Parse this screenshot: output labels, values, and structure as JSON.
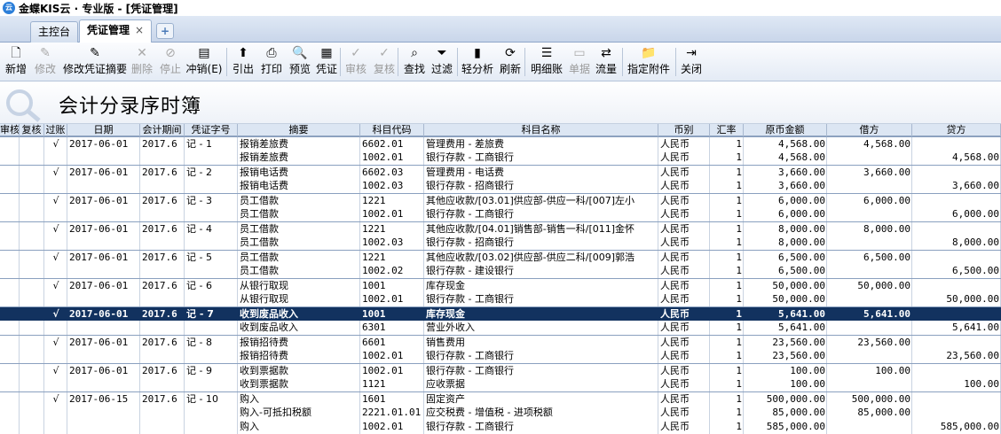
{
  "window": {
    "title": "金蝶KIS云 · 专业版 - [凭证管理]"
  },
  "tabs": [
    {
      "label": "主控台",
      "active": false
    },
    {
      "label": "凭证管理",
      "active": true,
      "close": "×"
    }
  ],
  "tab_add": "+",
  "toolbar": [
    {
      "label": "新增",
      "icon": "new-doc-icon",
      "glyph": "🗋",
      "enabled": true
    },
    {
      "label": "修改",
      "icon": "edit-icon",
      "glyph": "✎",
      "enabled": false
    },
    {
      "label": "修改凭证摘要",
      "icon": "edit-summary-icon",
      "glyph": "✎",
      "enabled": true
    },
    {
      "label": "删除",
      "icon": "delete-icon",
      "glyph": "✕",
      "enabled": false
    },
    {
      "label": "停止",
      "icon": "stop-icon",
      "glyph": "⊘",
      "enabled": false
    },
    {
      "label": "冲销(E)",
      "icon": "reverse-icon",
      "glyph": "▤",
      "enabled": true
    },
    {
      "label": "引出",
      "icon": "export-icon",
      "glyph": "⬆",
      "enabled": true
    },
    {
      "label": "打印",
      "icon": "print-icon",
      "glyph": "⎙",
      "enabled": true
    },
    {
      "label": "预览",
      "icon": "preview-icon",
      "glyph": "🔍",
      "enabled": true
    },
    {
      "label": "凭证",
      "icon": "voucher-icon",
      "glyph": "▦",
      "enabled": true
    },
    {
      "label": "审核",
      "icon": "audit-icon",
      "glyph": "✓",
      "enabled": false
    },
    {
      "label": "复核",
      "icon": "recheck-icon",
      "glyph": "✓",
      "enabled": false
    },
    {
      "label": "查找",
      "icon": "find-icon",
      "glyph": "⌕",
      "enabled": true
    },
    {
      "label": "过滤",
      "icon": "filter-icon",
      "glyph": "⏷",
      "enabled": true
    },
    {
      "label": "轻分析",
      "icon": "analysis-icon",
      "glyph": "▮",
      "enabled": true
    },
    {
      "label": "刷新",
      "icon": "refresh-icon",
      "glyph": "⟳",
      "enabled": true
    },
    {
      "label": "明细账",
      "icon": "ledger-icon",
      "glyph": "☰",
      "enabled": true
    },
    {
      "label": "单据",
      "icon": "document-icon",
      "glyph": "▭",
      "enabled": false
    },
    {
      "label": "流量",
      "icon": "flow-icon",
      "glyph": "⇄",
      "enabled": true
    },
    {
      "label": "指定附件",
      "icon": "attachment-icon",
      "glyph": "📁",
      "enabled": true
    },
    {
      "label": "关闭",
      "icon": "exit-icon",
      "glyph": "⇥",
      "enabled": true
    }
  ],
  "banner": {
    "title": "会计分录序时簿"
  },
  "columns": [
    "审核",
    "复核",
    "过账",
    "日期",
    "会计期间",
    "凭证字号",
    "摘要",
    "科目代码",
    "科目名称",
    "币别",
    "汇率",
    "原币金额",
    "借方",
    "贷方"
  ],
  "rows": [
    {
      "posted": "√",
      "date": "2017-06-01",
      "period": "2017.6",
      "voucher": "记 - 1",
      "summary": "报销差旅费",
      "code": "6602.01",
      "name": "管理费用 - 差旅费",
      "currency": "人民币",
      "rate": "1",
      "amount": "4,568.00",
      "debit": "4,568.00",
      "credit": ""
    },
    {
      "posted": "",
      "date": "",
      "period": "",
      "voucher": "",
      "summary": "报销差旅费",
      "code": "1002.01",
      "name": "银行存款 - 工商银行",
      "currency": "人民币",
      "rate": "1",
      "amount": "4,568.00",
      "debit": "",
      "credit": "4,568.00"
    },
    {
      "posted": "√",
      "date": "2017-06-01",
      "period": "2017.6",
      "voucher": "记 - 2",
      "summary": "报销电话费",
      "code": "6602.03",
      "name": "管理费用 - 电话费",
      "currency": "人民币",
      "rate": "1",
      "amount": "3,660.00",
      "debit": "3,660.00",
      "credit": ""
    },
    {
      "posted": "",
      "date": "",
      "period": "",
      "voucher": "",
      "summary": "报销电话费",
      "code": "1002.03",
      "name": "银行存款 - 招商银行",
      "currency": "人民币",
      "rate": "1",
      "amount": "3,660.00",
      "debit": "",
      "credit": "3,660.00"
    },
    {
      "posted": "√",
      "date": "2017-06-01",
      "period": "2017.6",
      "voucher": "记 - 3",
      "summary": "员工借款",
      "code": "1221",
      "name": "其他应收款/[03.01]供应部-供应一科/[007]左小",
      "currency": "人民币",
      "rate": "1",
      "amount": "6,000.00",
      "debit": "6,000.00",
      "credit": ""
    },
    {
      "posted": "",
      "date": "",
      "period": "",
      "voucher": "",
      "summary": "员工借款",
      "code": "1002.01",
      "name": "银行存款 - 工商银行",
      "currency": "人民币",
      "rate": "1",
      "amount": "6,000.00",
      "debit": "",
      "credit": "6,000.00"
    },
    {
      "posted": "√",
      "date": "2017-06-01",
      "period": "2017.6",
      "voucher": "记 - 4",
      "summary": "员工借款",
      "code": "1221",
      "name": "其他应收款/[04.01]销售部-销售一科/[011]金怀",
      "currency": "人民币",
      "rate": "1",
      "amount": "8,000.00",
      "debit": "8,000.00",
      "credit": ""
    },
    {
      "posted": "",
      "date": "",
      "period": "",
      "voucher": "",
      "summary": "员工借款",
      "code": "1002.03",
      "name": "银行存款 - 招商银行",
      "currency": "人民币",
      "rate": "1",
      "amount": "8,000.00",
      "debit": "",
      "credit": "8,000.00"
    },
    {
      "posted": "√",
      "date": "2017-06-01",
      "period": "2017.6",
      "voucher": "记 - 5",
      "summary": "员工借款",
      "code": "1221",
      "name": "其他应收款/[03.02]供应部-供应二科/[009]郭浩",
      "currency": "人民币",
      "rate": "1",
      "amount": "6,500.00",
      "debit": "6,500.00",
      "credit": ""
    },
    {
      "posted": "",
      "date": "",
      "period": "",
      "voucher": "",
      "summary": "员工借款",
      "code": "1002.02",
      "name": "银行存款 - 建设银行",
      "currency": "人民币",
      "rate": "1",
      "amount": "6,500.00",
      "debit": "",
      "credit": "6,500.00"
    },
    {
      "posted": "√",
      "date": "2017-06-01",
      "period": "2017.6",
      "voucher": "记 - 6",
      "summary": "从银行取现",
      "code": "1001",
      "name": "库存现金",
      "currency": "人民币",
      "rate": "1",
      "amount": "50,000.00",
      "debit": "50,000.00",
      "credit": ""
    },
    {
      "posted": "",
      "date": "",
      "period": "",
      "voucher": "",
      "summary": "从银行取现",
      "code": "1002.01",
      "name": "银行存款 - 工商银行",
      "currency": "人民币",
      "rate": "1",
      "amount": "50,000.00",
      "debit": "",
      "credit": "50,000.00"
    },
    {
      "posted": "√",
      "date": "2017-06-01",
      "period": "2017.6",
      "voucher": "记 - 7",
      "summary": "收到废品收入",
      "code": "1001",
      "name": "库存现金",
      "currency": "人民币",
      "rate": "1",
      "amount": "5,641.00",
      "debit": "5,641.00",
      "credit": "",
      "selected": true
    },
    {
      "posted": "",
      "date": "",
      "period": "",
      "voucher": "",
      "summary": "收到废品收入",
      "code": "6301",
      "name": "营业外收入",
      "currency": "人民币",
      "rate": "1",
      "amount": "5,641.00",
      "debit": "",
      "credit": "5,641.00"
    },
    {
      "posted": "√",
      "date": "2017-06-01",
      "period": "2017.6",
      "voucher": "记 - 8",
      "summary": "报销招待费",
      "code": "6601",
      "name": "销售费用",
      "currency": "人民币",
      "rate": "1",
      "amount": "23,560.00",
      "debit": "23,560.00",
      "credit": ""
    },
    {
      "posted": "",
      "date": "",
      "period": "",
      "voucher": "",
      "summary": "报销招待费",
      "code": "1002.01",
      "name": "银行存款 - 工商银行",
      "currency": "人民币",
      "rate": "1",
      "amount": "23,560.00",
      "debit": "",
      "credit": "23,560.00"
    },
    {
      "posted": "√",
      "date": "2017-06-01",
      "period": "2017.6",
      "voucher": "记 - 9",
      "summary": "收到票据款",
      "code": "1002.01",
      "name": "银行存款 - 工商银行",
      "currency": "人民币",
      "rate": "1",
      "amount": "100.00",
      "debit": "100.00",
      "credit": ""
    },
    {
      "posted": "",
      "date": "",
      "period": "",
      "voucher": "",
      "summary": "收到票据款",
      "code": "1121",
      "name": "应收票据",
      "currency": "人民币",
      "rate": "1",
      "amount": "100.00",
      "debit": "",
      "credit": "100.00"
    },
    {
      "posted": "√",
      "date": "2017-06-15",
      "period": "2017.6",
      "voucher": "记 - 10",
      "summary": "购入",
      "code": "1601",
      "name": "固定资产",
      "currency": "人民币",
      "rate": "1",
      "amount": "500,000.00",
      "debit": "500,000.00",
      "credit": ""
    },
    {
      "posted": "",
      "date": "",
      "period": "",
      "voucher": "",
      "summary": "购入-可抵扣税额",
      "code": "2221.01.01",
      "name": "应交税费 - 增值税 - 进项税额",
      "currency": "人民币",
      "rate": "1",
      "amount": "85,000.00",
      "debit": "85,000.00",
      "credit": ""
    },
    {
      "posted": "",
      "date": "",
      "period": "",
      "voucher": "",
      "summary": "购入",
      "code": "1002.01",
      "name": "银行存款 - 工商银行",
      "currency": "人民币",
      "rate": "1",
      "amount": "585,000.00",
      "debit": "",
      "credit": "585,000.00"
    }
  ]
}
